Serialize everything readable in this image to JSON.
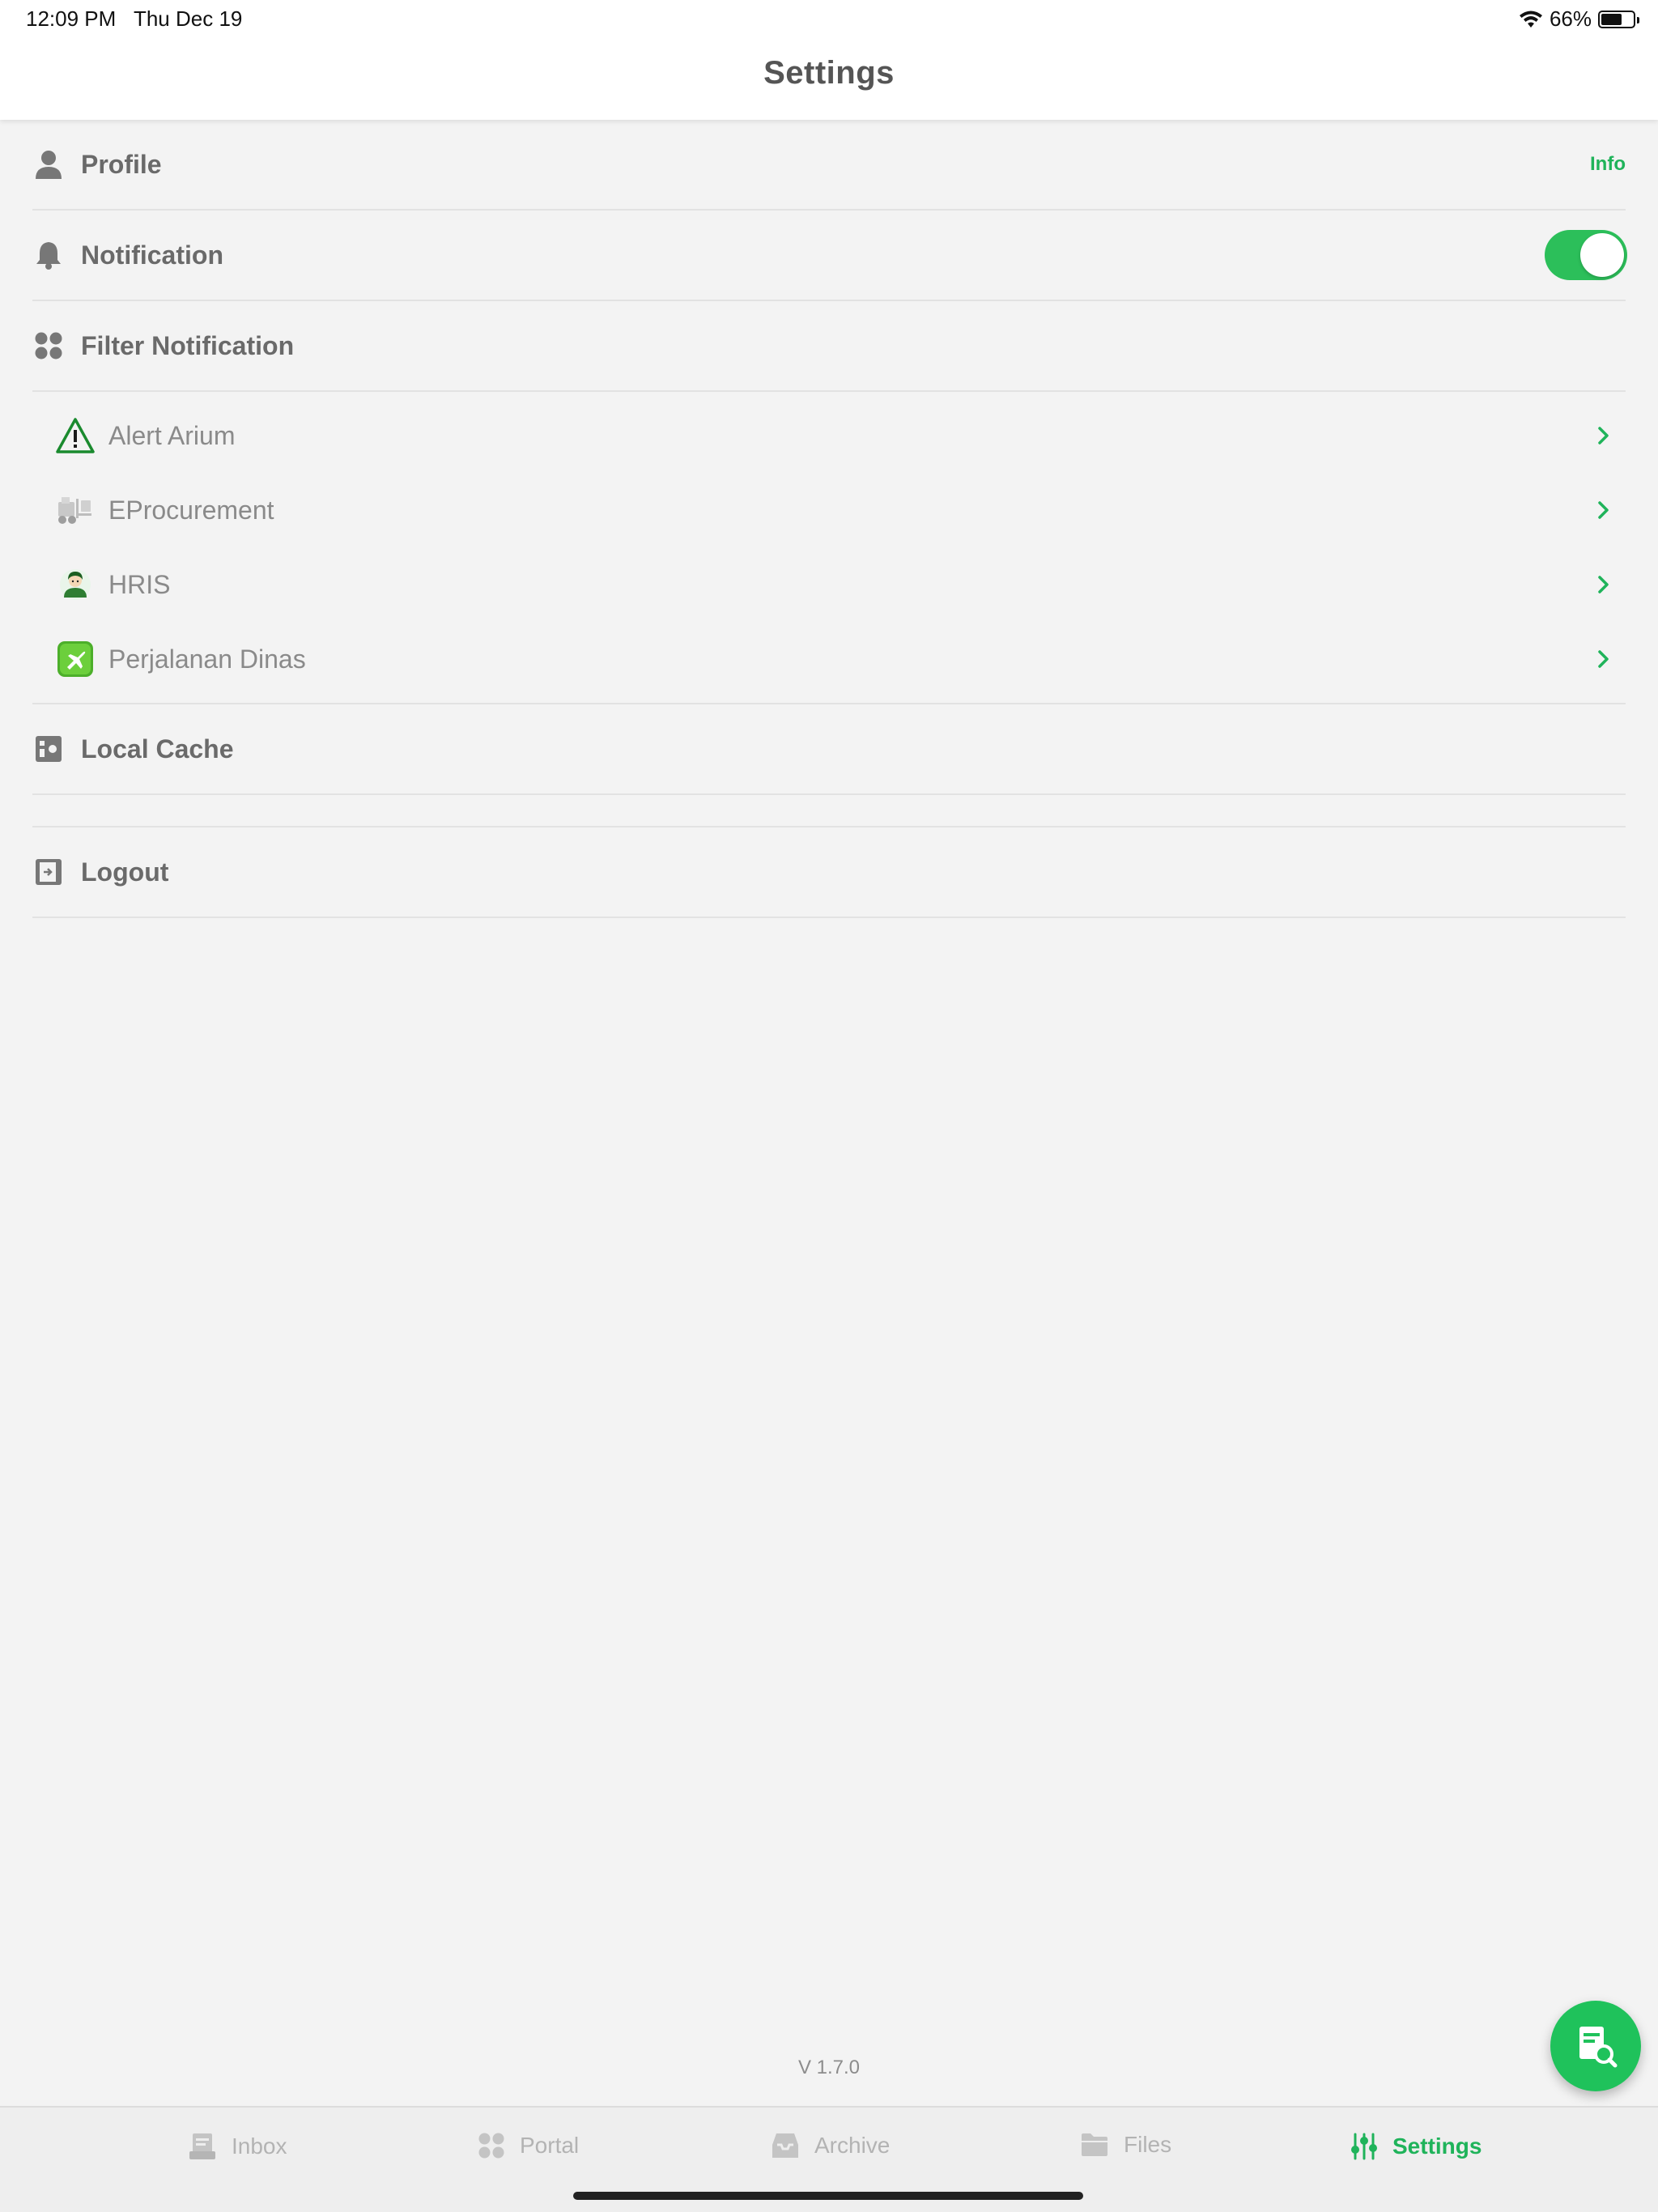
{
  "status": {
    "time": "12:09 PM",
    "date": "Thu Dec 19",
    "battery": "66%",
    "battery_level": 0.66
  },
  "header": {
    "title": "Settings"
  },
  "settings": {
    "profile_label": "Profile",
    "profile_info": "Info",
    "notification_label": "Notification",
    "notification_enabled": true,
    "filter_label": "Filter Notification",
    "filters": [
      {
        "label": "Alert Arium",
        "icon": "warning-triangle-icon"
      },
      {
        "label": "EProcurement",
        "icon": "forklift-icon"
      },
      {
        "label": "HRIS",
        "icon": "person-avatar-icon"
      },
      {
        "label": "Perjalanan Dinas",
        "icon": "airplane-icon"
      }
    ],
    "local_cache_label": "Local Cache",
    "logout_label": "Logout"
  },
  "version": "V 1.7.0",
  "tabs": [
    {
      "label": "Inbox",
      "icon": "inbox-icon"
    },
    {
      "label": "Portal",
      "icon": "grid-dots-icon"
    },
    {
      "label": "Archive",
      "icon": "archive-tray-icon"
    },
    {
      "label": "Files",
      "icon": "folder-icon"
    },
    {
      "label": "Settings",
      "icon": "sliders-icon",
      "active": true
    }
  ],
  "colors": {
    "accent": "#1fb35a",
    "toggle_on": "#2cbf5a",
    "background": "#f3f3f3"
  }
}
